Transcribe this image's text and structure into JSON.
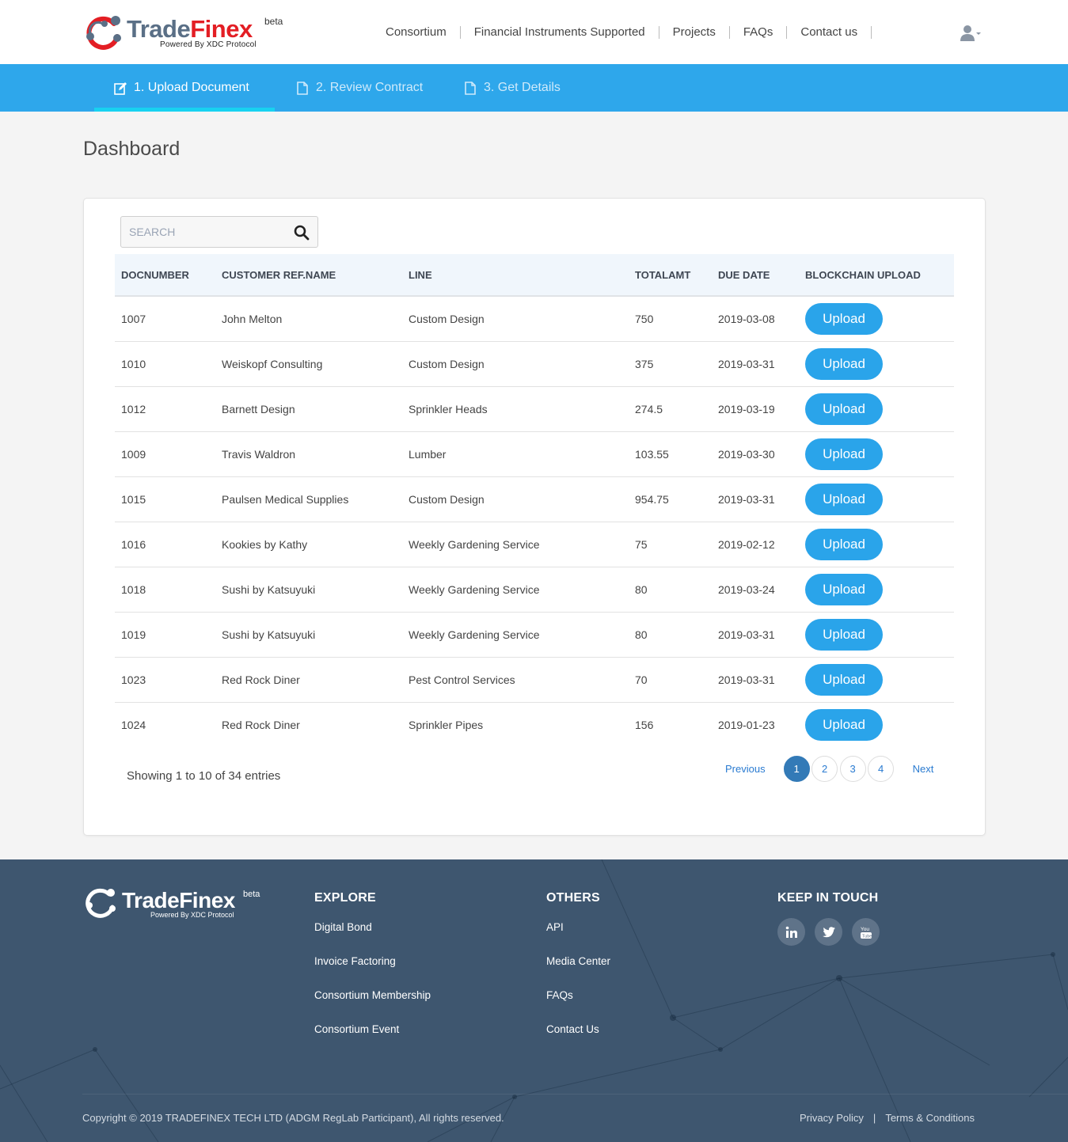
{
  "brand": {
    "name_part1": "Trade",
    "name_part2": "Finex",
    "badge": "beta",
    "tagline": "Powered By XDC Protocol",
    "footer_name": "TradeFinex"
  },
  "nav": {
    "items": [
      {
        "label": "Consortium"
      },
      {
        "label": "Financial Instruments Supported"
      },
      {
        "label": "Projects"
      },
      {
        "label": "FAQs"
      },
      {
        "label": "Contact us"
      }
    ]
  },
  "steps": [
    {
      "label": "1. Upload Document",
      "icon": "edit-icon",
      "active": true
    },
    {
      "label": "2. Review Contract",
      "icon": "document-icon",
      "active": false
    },
    {
      "label": "3. Get Details",
      "icon": "document-icon",
      "active": false
    }
  ],
  "page": {
    "title": "Dashboard"
  },
  "search": {
    "placeholder": "SEARCH",
    "value": ""
  },
  "table": {
    "columns": [
      "DOCNUMBER",
      "CUSTOMER REF.NAME",
      "LINE",
      "TOTALAMT",
      "DUE DATE",
      "BLOCKCHAIN UPLOAD"
    ],
    "button_label": "Upload",
    "rows": [
      {
        "doc": "1007",
        "customer": "John Melton",
        "line": "Custom Design",
        "amt": "750",
        "due": "2019-03-08"
      },
      {
        "doc": "1010",
        "customer": "Weiskopf Consulting",
        "line": "Custom Design",
        "amt": "375",
        "due": "2019-03-31"
      },
      {
        "doc": "1012",
        "customer": "Barnett Design",
        "line": "Sprinkler Heads",
        "amt": "274.5",
        "due": "2019-03-19"
      },
      {
        "doc": "1009",
        "customer": "Travis Waldron",
        "line": "Lumber",
        "amt": "103.55",
        "due": "2019-03-30"
      },
      {
        "doc": "1015",
        "customer": "Paulsen Medical Supplies",
        "line": "Custom Design",
        "amt": "954.75",
        "due": "2019-03-31"
      },
      {
        "doc": "1016",
        "customer": "Kookies by Kathy",
        "line": "Weekly Gardening Service",
        "amt": "75",
        "due": "2019-02-12"
      },
      {
        "doc": "1018",
        "customer": "Sushi by Katsuyuki",
        "line": "Weekly Gardening Service",
        "amt": "80",
        "due": "2019-03-24"
      },
      {
        "doc": "1019",
        "customer": "Sushi by Katsuyuki",
        "line": "Weekly Gardening Service",
        "amt": "80",
        "due": "2019-03-31"
      },
      {
        "doc": "1023",
        "customer": "Red Rock Diner",
        "line": "Pest Control Services",
        "amt": "70",
        "due": "2019-03-31"
      },
      {
        "doc": "1024",
        "customer": "Red Rock Diner",
        "line": "Sprinkler Pipes",
        "amt": "156",
        "due": "2019-01-23"
      }
    ]
  },
  "pagination": {
    "info": "Showing 1 to 10 of 34 entries",
    "previous": "Previous",
    "next": "Next",
    "pages": [
      "1",
      "2",
      "3",
      "4"
    ],
    "current": "1"
  },
  "footer": {
    "explore": {
      "heading": "EXPLORE",
      "links": [
        "Digital Bond",
        "Invoice Factoring",
        "Consortium Membership",
        "Consortium Event"
      ]
    },
    "others": {
      "heading": "OTHERS",
      "links": [
        "API",
        "Media Center",
        "FAQs",
        "Contact Us"
      ]
    },
    "keep_in_touch": {
      "heading": "KEEP IN TOUCH",
      "social": [
        "linkedin-icon",
        "twitter-icon",
        "youtube-icon"
      ]
    },
    "copyright": "Copyright © 2019 TRADEFINEX TECH LTD (ADGM RegLab Participant), All rights reserved.",
    "privacy": "Privacy Policy",
    "separator": "|",
    "terms": "Terms & Conditions"
  },
  "colors": {
    "accent": "#2ea7eb",
    "step_underline": "#18d2f0",
    "button": "#2aa4ea",
    "pager_active": "#337ab7",
    "footer_bg": "#3e566f",
    "brand_red": "#e31e24"
  }
}
